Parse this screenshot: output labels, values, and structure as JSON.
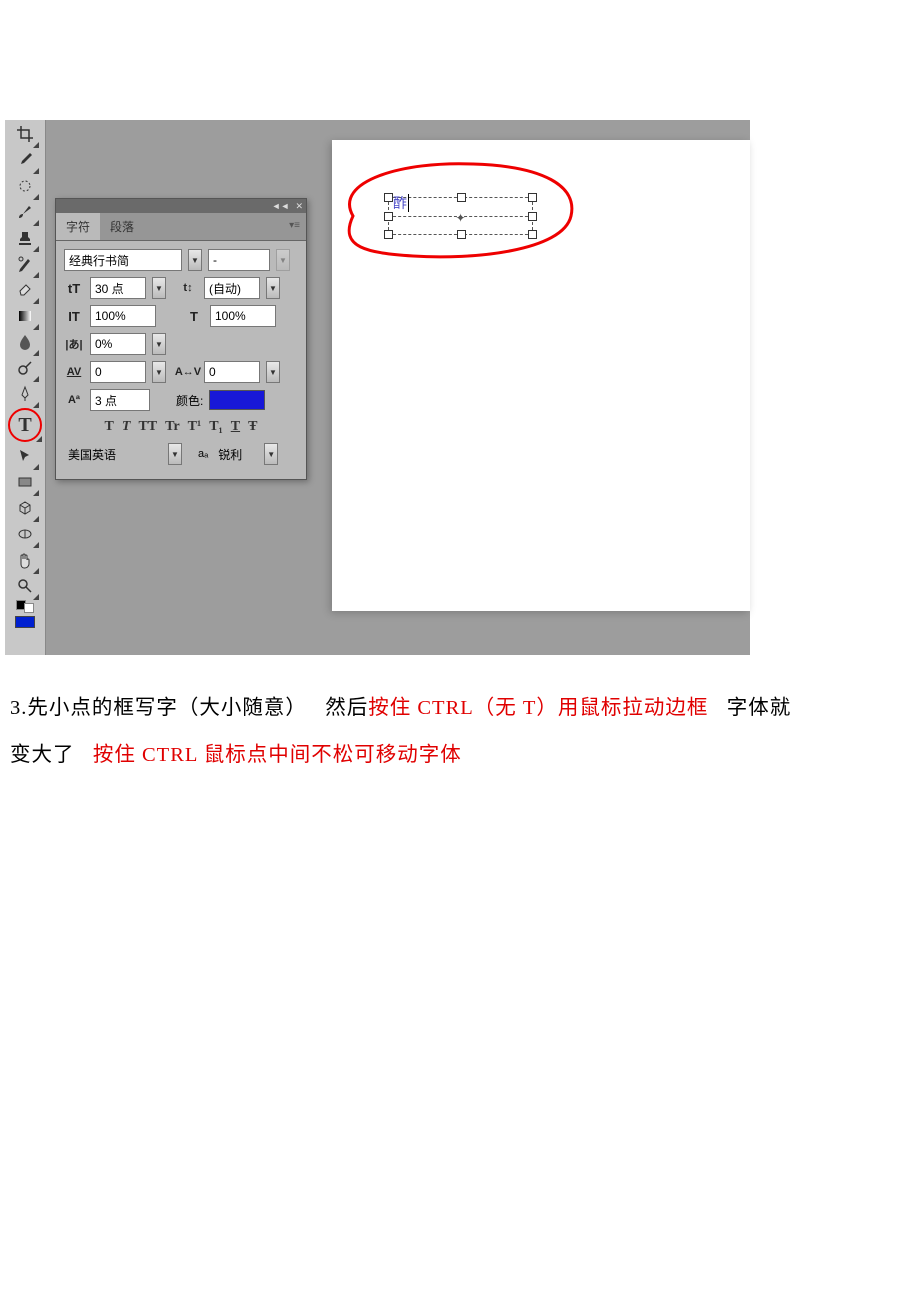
{
  "panel": {
    "tab_char": "字符",
    "tab_para": "段落",
    "font_family": "经典行书简",
    "font_style": "-",
    "font_size": "30 点",
    "leading": "(自动)",
    "vscale": "100%",
    "hscale": "100%",
    "tsume": "0%",
    "tracking": "0",
    "kerning": "0",
    "baseline": "3 点",
    "color_label": "颜色:",
    "language": "美国英语",
    "antialias": "锐利"
  },
  "style": {
    "bold": "T",
    "italic": "T",
    "allcaps": "TT",
    "smallcaps": "Tr",
    "super": "T¹",
    "sub": "T₁",
    "underline": "T",
    "strike": "Ŧ"
  },
  "sample": "酢",
  "instruction": {
    "p1": "3.先小点的框写字（大小随意）",
    "p2": "然后",
    "p3": "按住 CTRL（无 T）用鼠标拉动边框",
    "p4": "字体就",
    "p5": "变大了",
    "p6": "按住 CTRL 鼠标点中间不松可移动字体"
  }
}
